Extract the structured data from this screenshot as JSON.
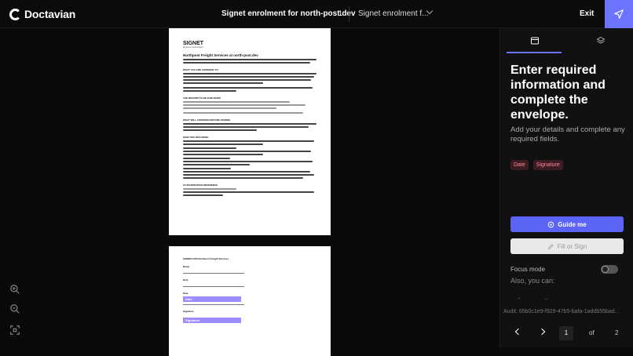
{
  "header": {
    "brand": "Doctavian",
    "doc_title": "Signet enrolment for north-post.dev",
    "doc_count": "1",
    "doc_select": "Signet enrolment f...",
    "exit_label": "Exit"
  },
  "page1": {
    "heading": "SIGNET",
    "subheading": "Enrolment authorisation",
    "title": "Northpost Freight Services at north-post.dev",
    "sec1": "WHAT YOU ARE AGREEING TO",
    "sec2": "THE RECORD TO BE PUBLISHED",
    "sec3": "WHAT WILL CONSIDER BEFORE SIGNING",
    "sec4": "HOW THIS WAS MADE",
    "sec5": "AUTHORISATION REFERENCE"
  },
  "page2": {
    "signer": "SIGNED FOR Northpost Freight Services",
    "name_label": "Name",
    "role_label": "Role",
    "date_label": "Date",
    "date_field": "Date",
    "signature_label": "Signature",
    "signature_field": "Signature"
  },
  "sidebar": {
    "title": "Enter required information and complete the envelope.",
    "subtitle": "Add your details and complete any required fields.",
    "badges": [
      "Date",
      "Signature"
    ],
    "guide_label": "Guide me",
    "fill_label": "Fill or Sign",
    "focus_label": "Focus mode",
    "also_label": "Also, you can:",
    "audit": "Audit: 65b0c1e9-f929-47b5-bafa-1addb55bad...",
    "page_current": "1",
    "page_of": "of",
    "page_total": "2"
  },
  "colors": {
    "accent": "#6b73ff",
    "badge_text": "#ff8a9a",
    "field": "#9b8cff"
  },
  "icons": [
    "logo-icon",
    "send-icon",
    "chevron-down-icon",
    "document-tab-icon",
    "layers-tab-icon",
    "zoom-in-icon",
    "zoom-out-icon",
    "fit-screen-icon",
    "guide-icon",
    "sign-icon",
    "chevron-left-icon",
    "chevron-right-icon"
  ]
}
